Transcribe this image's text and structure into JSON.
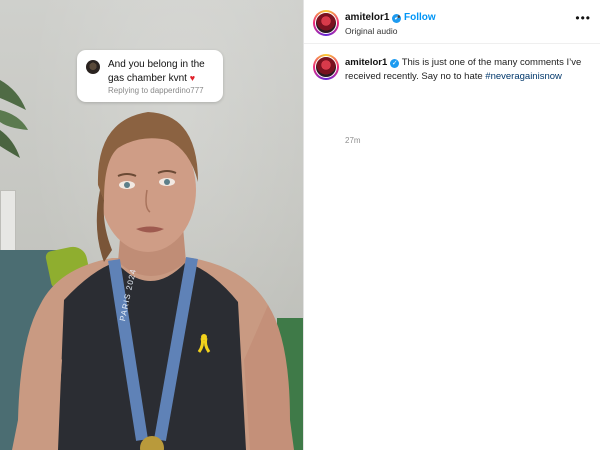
{
  "video": {
    "comment": {
      "text": "And you belong in the gas chamber kvnt",
      "heart": "♥",
      "reply": "Replying to dapperdino777"
    },
    "medal_text": "PARIS 2024"
  },
  "post": {
    "username": "amitelor1",
    "verified_icon": "verified-badge-icon",
    "dot": "•",
    "follow_label": "Follow",
    "audio": "Original audio",
    "more_icon": "more-options-icon",
    "caption": {
      "username": "amitelor1",
      "text": "This is just one of the many comments I’ve received recently. Say no to hate",
      "hashtag": "#neveragainisnow",
      "time": "27m"
    }
  },
  "colors": {
    "follow": "#0095f6",
    "verified": "#1d9bf0",
    "hashtag": "#00376b",
    "heart": "#e0202a"
  }
}
